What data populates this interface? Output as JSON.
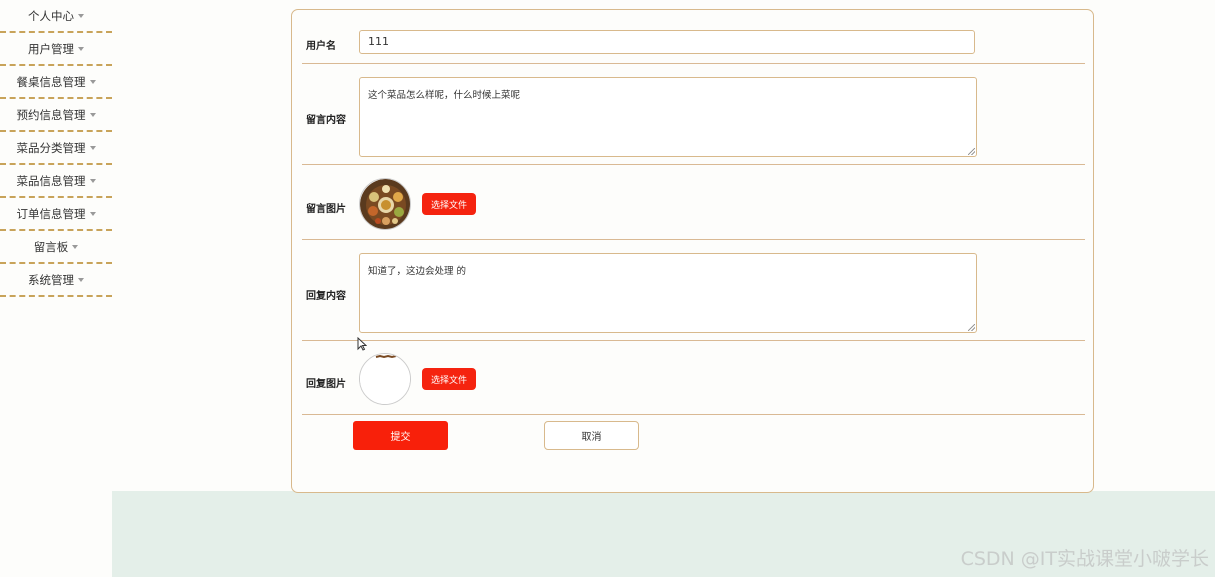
{
  "sidebar": {
    "items": [
      {
        "label": "个人中心"
      },
      {
        "label": "用户管理"
      },
      {
        "label": "餐桌信息管理"
      },
      {
        "label": "预约信息管理"
      },
      {
        "label": "菜品分类管理"
      },
      {
        "label": "菜品信息管理"
      },
      {
        "label": "订单信息管理"
      },
      {
        "label": "留言板"
      },
      {
        "label": "系统管理"
      }
    ]
  },
  "form": {
    "username_label": "用户名",
    "username_value": "111",
    "message_label": "留言内容",
    "message_value": "这个菜品怎么样呢，什么时候上菜呢",
    "message_image_label": "留言图片",
    "reply_label": "回复内容",
    "reply_value": "知道了，这边会处理 的",
    "reply_image_label": "回复图片",
    "choose_file_label": "选择文件",
    "submit_label": "提交",
    "cancel_label": "取消"
  },
  "watermark": "CSDN @IT实战课堂小啵学长",
  "colors": {
    "accent_red": "#f5230f",
    "border_tan": "#d8b98c",
    "dashed_gold": "#c8a35a",
    "footer_green": "#e4efe9"
  }
}
